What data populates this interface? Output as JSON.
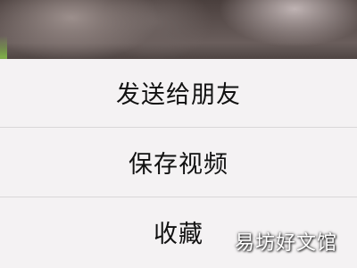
{
  "action_sheet": {
    "options": [
      {
        "label": "发送给朋友"
      },
      {
        "label": "保存视频"
      },
      {
        "label": "收藏"
      }
    ]
  },
  "watermark": {
    "text": "易坊好文馆"
  },
  "colors": {
    "sheet_background": "#f4f2f3",
    "divider": "#d9d7d8",
    "text": "#111111"
  }
}
